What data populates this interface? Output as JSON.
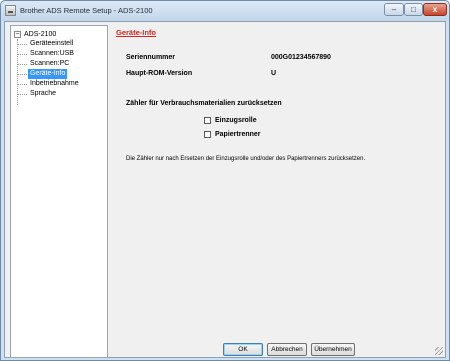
{
  "window": {
    "title": "Brother ADS Remote Setup - ADS-2100",
    "controls": {
      "minimize": "–",
      "maximize": "□",
      "close": "x"
    }
  },
  "tree": {
    "root": "ADS-2100",
    "expander": "−",
    "items": [
      {
        "label": "Geräteeinstell"
      },
      {
        "label": "Scannen:USB"
      },
      {
        "label": "Scannen:PC"
      },
      {
        "label": "Geräte-Info",
        "selected": true
      },
      {
        "label": "Inbetriebnahme"
      },
      {
        "label": "Sprache"
      }
    ]
  },
  "content": {
    "heading": "Geräte-Info",
    "fields": [
      {
        "label": "Seriennummer",
        "value": "000G01234567890"
      },
      {
        "label": "Haupt-ROM-Version",
        "value": "U"
      }
    ],
    "reset_title": "Zähler für Verbrauchsmaterialien zurücksetzen",
    "checkboxes": [
      {
        "label": "Einzugsrolle",
        "checked": false
      },
      {
        "label": "Papiertrenner",
        "checked": false
      }
    ],
    "note": "Die Zähler nur nach Ersetzen der Einzugsrolle und/oder des Papiertrenners zurücksetzen."
  },
  "buttons": {
    "ok": "OK",
    "cancel": "Abbrechen",
    "apply": "Übernehmen"
  },
  "colors": {
    "heading": "#d2261f",
    "selection": "#3399ff"
  }
}
